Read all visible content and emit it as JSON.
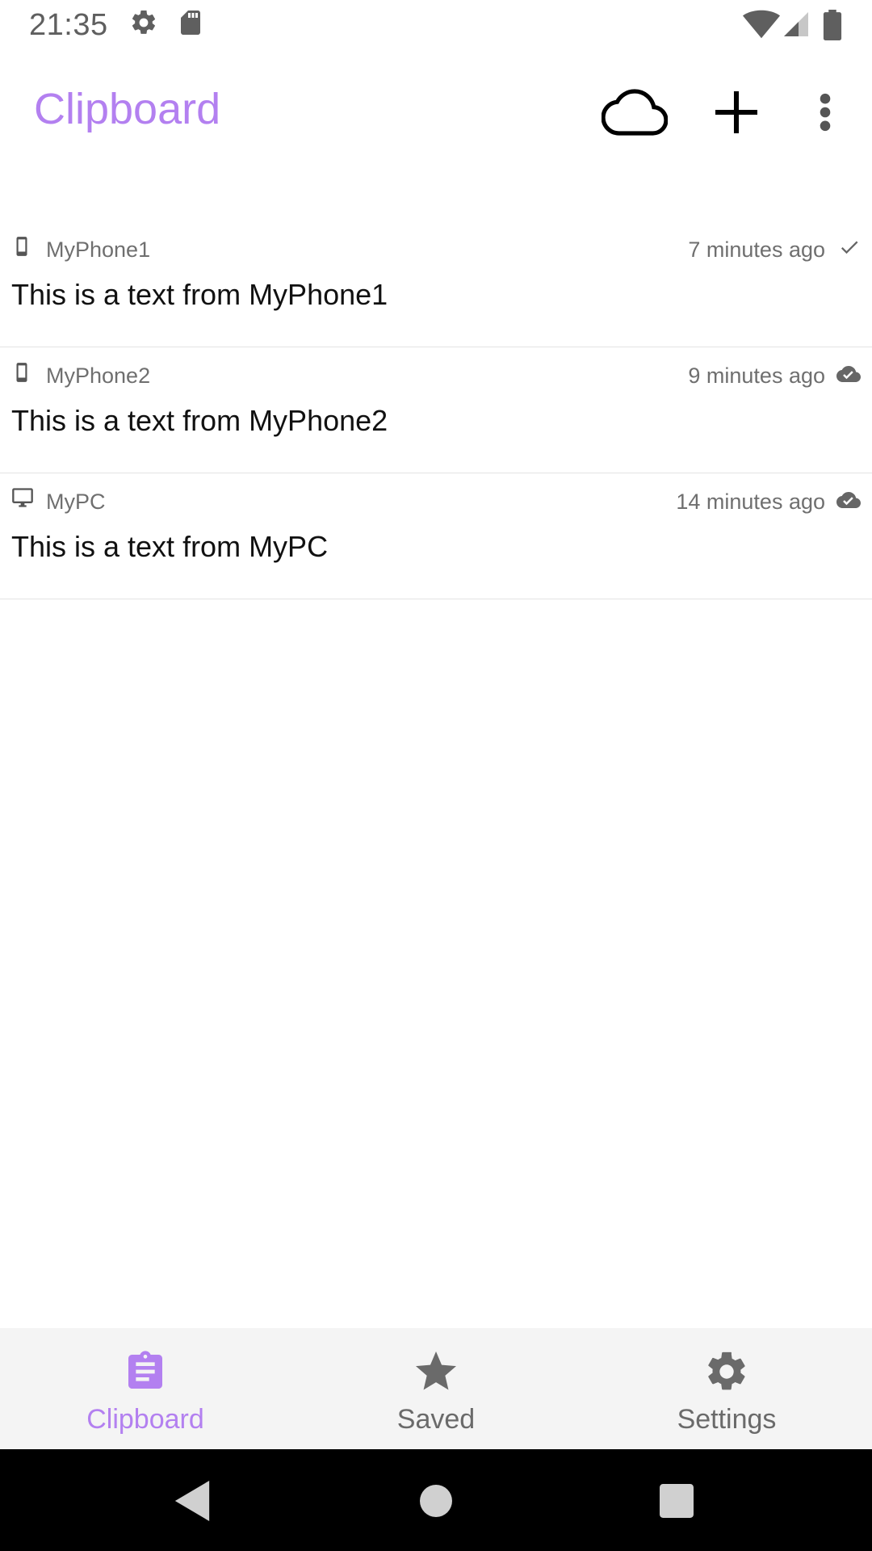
{
  "status": {
    "time": "21:35",
    "icons": [
      "gear-icon",
      "sd-card-icon",
      "wifi-icon",
      "signal-icon",
      "battery-icon"
    ]
  },
  "appbar": {
    "title": "Clipboard",
    "actions": [
      "cloud-icon",
      "add-icon",
      "more-vert-icon"
    ]
  },
  "colors": {
    "accent": "#b380f0",
    "muted_text": "#6f6f6f",
    "nav_background": "#f4f4f4"
  },
  "items": [
    {
      "device": "MyPhone1",
      "device_icon": "phone-icon",
      "time": "7 minutes ago",
      "status_icon": "check-icon",
      "text": "This is a text from MyPhone1"
    },
    {
      "device": "MyPhone2",
      "device_icon": "phone-icon",
      "time": "9 minutes ago",
      "status_icon": "cloud-done-icon",
      "text": "This is a text from MyPhone2"
    },
    {
      "device": "MyPC",
      "device_icon": "desktop-icon",
      "time": "14 minutes ago",
      "status_icon": "cloud-done-icon",
      "text": "This is a text from MyPC"
    }
  ],
  "bottom_nav": [
    {
      "label": "Clipboard",
      "icon": "clipboard-icon",
      "active": true
    },
    {
      "label": "Saved",
      "icon": "star-icon",
      "active": false
    },
    {
      "label": "Settings",
      "icon": "gear-icon",
      "active": false
    }
  ],
  "system_nav": [
    "back-icon",
    "home-icon",
    "recents-icon"
  ]
}
